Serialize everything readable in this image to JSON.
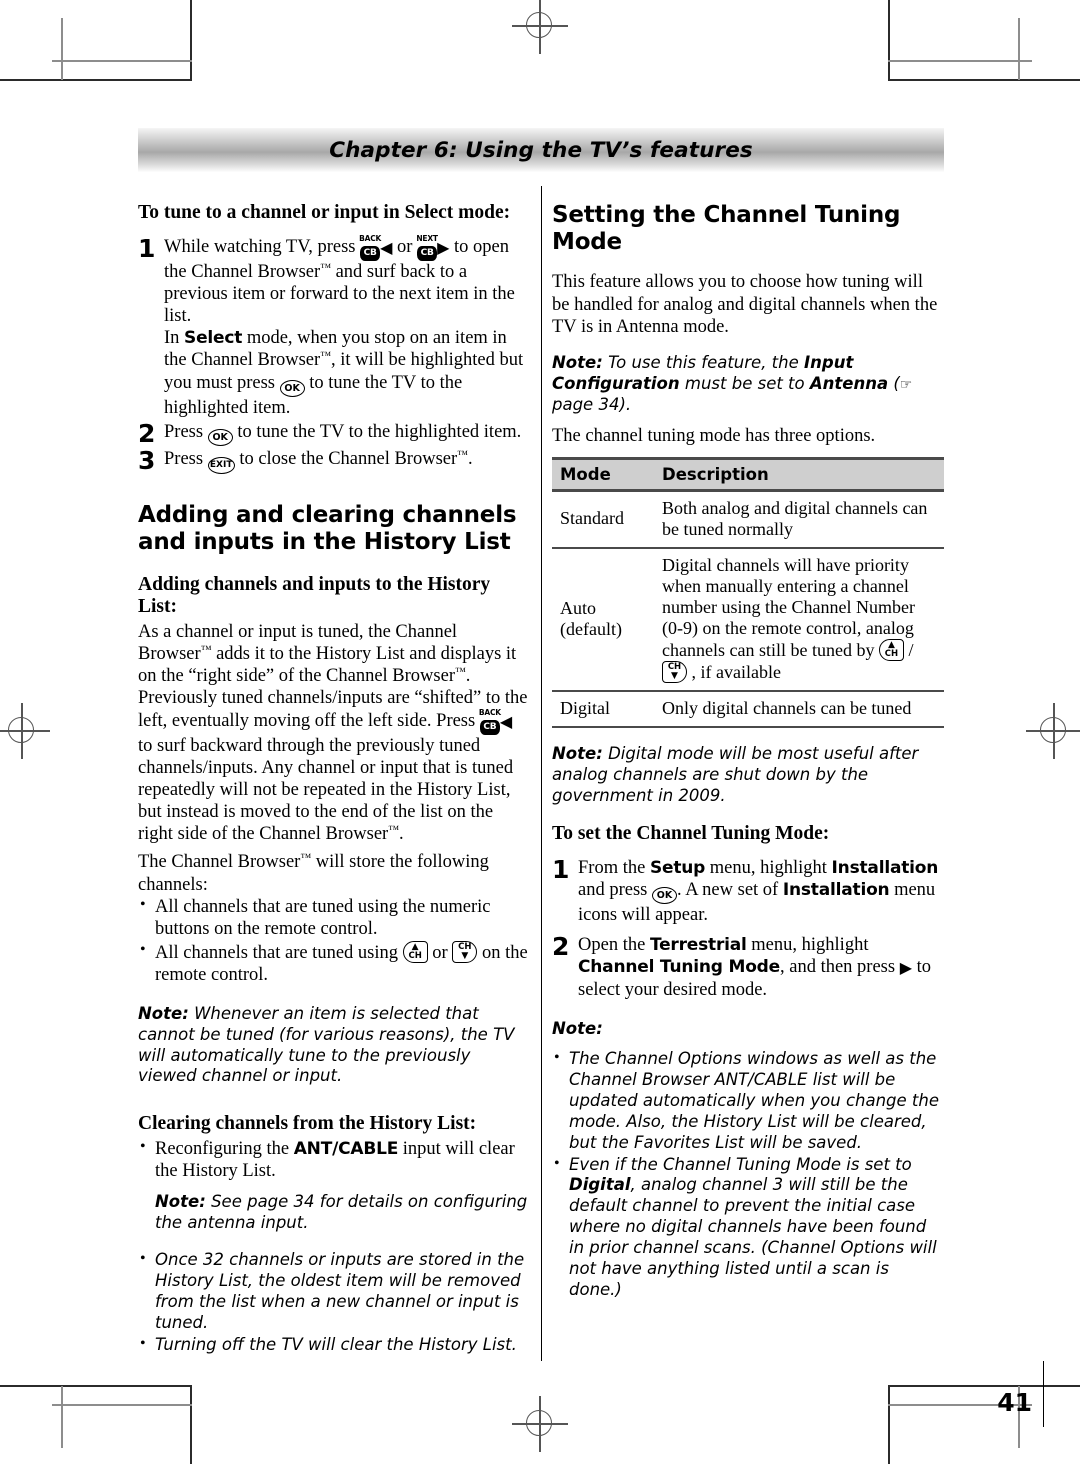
{
  "header": {
    "chapter_title": "Chapter 6: Using the TV’s features"
  },
  "left_column": {
    "heading_select_mode": "To tune to a channel or input in Select mode:",
    "steps": [
      {
        "num": "1",
        "line1_a": "While watching TV, press ",
        "line1_b": " or ",
        "line1_c": " to open the Channel Browser",
        "line1_d": " and surf back to a previous item or forward to the next item in the list.",
        "line2_a": "In ",
        "line2_bold": "Select",
        "line2_b": " mode, when you stop on an item in the Channel Browser",
        "line2_c": ", it will be highlighted but you must press ",
        "line2_d": " to tune the TV to the highlighted item."
      },
      {
        "num": "2",
        "text_a": "Press ",
        "text_b": " to tune the TV to the highlighted item."
      },
      {
        "num": "3",
        "text_a": "Press ",
        "text_b": " to close the Channel Browser",
        "text_c": "."
      }
    ],
    "heading_adding_clearing": "Adding and clearing channels and inputs in the History List",
    "heading_adding": "Adding channels and inputs to the History List:",
    "para_adding_1": "As a channel or input is tuned, the Channel Browser",
    "para_adding_2": " adds it to the History List and displays it on the “right side” of the Channel Browser",
    "para_adding_3": ". Previously tuned channels/inputs are “shifted” to the left, eventually moving off the left side. Press ",
    "para_adding_4": " to surf backward through the previously tuned channels/inputs. Any channel or input that is tuned repeatedly will not be repeated in the History List, but instead is moved to the end of the list on the right side of the Channel Browser",
    "para_adding_5": ".",
    "para_store_1": "The Channel Browser",
    "para_store_2": " will store the following channels:",
    "bullets_store": [
      "All channels that are tuned using the numeric buttons on the remote control."
    ],
    "bullet_chkeys_a": "All channels that are tuned using ",
    "bullet_chkeys_b": " or ",
    "bullet_chkeys_c": " on the remote control.",
    "note_cannot_tune": {
      "label": "Note:",
      "text": " Whenever an item is selected that cannot be tuned (for various reasons), the TV will automatically tune to the previously viewed channel or input."
    },
    "heading_clearing": "Clearing channels from the History List:",
    "bullet_reconfig_a": "Reconfiguring the ",
    "bullet_reconfig_bold": "ANT/CABLE",
    "bullet_reconfig_b": " input will clear the History List.",
    "note_see_page": {
      "label": "Note:",
      "text": " See page 34 for details on configuring the antenna input."
    },
    "italic_bullets": [
      "Once 32 channels or inputs are stored in the History List, the oldest item will be removed from the list when a new channel or input is tuned.",
      "Turning off the TV will clear the History List."
    ]
  },
  "right_column": {
    "heading_setting": "Setting the Channel Tuning Mode",
    "para_intro": "This feature allows you to choose how tuning will be handled for analog and digital channels when the TV is in Antenna mode.",
    "note_antenna": {
      "label": "Note:",
      "part1": " To use this feature, the ",
      "bold1": "Input Configuration",
      "part2": " must be set to ",
      "bold2": "Antenna",
      "part3": " (",
      "hand_icon": "hand-pointing-icon",
      "part4": " page 34)."
    },
    "para_three_options": "The channel tuning mode has three options.",
    "table": {
      "columns": [
        "Mode",
        "Description"
      ],
      "rows": [
        {
          "mode": "Standard",
          "description": "Both analog and digital channels can be tuned normally"
        },
        {
          "mode": "Auto\n(default)",
          "description_a": "Digital channels will have priority when manually entering a channel number using the Channel Number (0-9) on the remote control, analog channels can still be tuned by ",
          "description_sep": " / ",
          "description_b": " , if available"
        },
        {
          "mode": "Digital",
          "description": "Only digital channels can be tuned"
        }
      ]
    },
    "note_digital_mode": {
      "label": "Note:",
      "text": " Digital mode will be most useful after analog channels are shut down by the government in 2009."
    },
    "heading_to_set": "To set the Channel Tuning Mode:",
    "steps": [
      {
        "num": "1",
        "a": "From the ",
        "bold1": "Setup",
        "b": " menu, highlight ",
        "bold2": "Installation",
        "c": " and press ",
        "d": ". A new set of ",
        "bold3": "Installation",
        "e": " menu icons will appear."
      },
      {
        "num": "2",
        "a": "Open the ",
        "bold1": "Terrestrial",
        "b": " menu, highlight ",
        "bold2": "Channel Tuning Mode",
        "c": ", and then press ",
        "d": " to select your desired mode."
      }
    ],
    "note_label": "Note:",
    "note_bullets": [
      {
        "text": "The Channel Options windows as well as the Channel Browser ANT/CABLE list will be updated automatically when you change the mode. Also, the History List will be cleared, but the Favorites List will be saved."
      },
      {
        "a": "Even if the Channel Tuning Mode is set to ",
        "bold": "Digital",
        "b": ", analog channel 3 will still be the default channel to prevent the initial case where no digital channels have been found in prior channel scans. (Channel Options will not have anything listed until a scan is done.)"
      }
    ]
  },
  "footer": {
    "page_number": "41"
  },
  "glyphs": {
    "cb_back_cap": "BACK",
    "cb_next_cap": "NEXT",
    "cb_label": "CB",
    "ok_label": "OK",
    "exit_label": "EXIT",
    "ch_label": "CH",
    "arrow_left": "◀",
    "arrow_right": "▶",
    "arrow_up": "▲",
    "arrow_down": "▼",
    "trademark": "™",
    "hand": "☞"
  },
  "colors": {
    "text": "#000000",
    "header_bar_mid": "#a8a8a8",
    "table_header_bg": "#cfcfcf",
    "rule": "#4a4a4a"
  }
}
